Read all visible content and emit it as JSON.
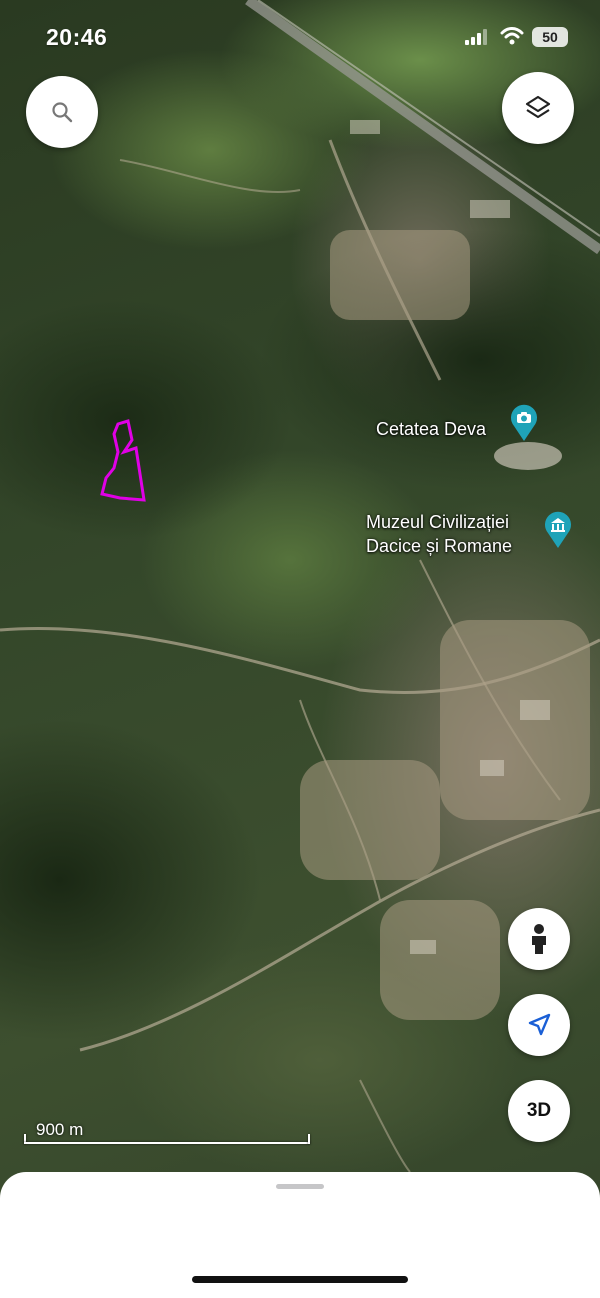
{
  "status_bar": {
    "time": "20:46",
    "battery": "50",
    "icons": [
      "signal-icon",
      "wifi-icon",
      "battery-icon"
    ]
  },
  "map": {
    "type": "satellite",
    "places": [
      {
        "name": "Cetatea Deva",
        "icon": "camera-poi-icon",
        "color": "#1fa3b8"
      },
      {
        "name": "Muzeul Civilizației Dacice și Romane",
        "line1": "Muzeul Civilizației",
        "line2": "Dacice și Romane",
        "icon": "museum-poi-icon",
        "color": "#1fa3b8"
      }
    ],
    "boundary_color": "#e000e6",
    "scale": {
      "label": "900 m"
    }
  },
  "controls": {
    "search_icon": "search-icon",
    "layers_icon": "layers-icon",
    "streetview_icon": "person-icon",
    "location_icon": "navigation-arrow-icon",
    "view3d_label": "3D",
    "accent_color": "#1a5fd6"
  }
}
